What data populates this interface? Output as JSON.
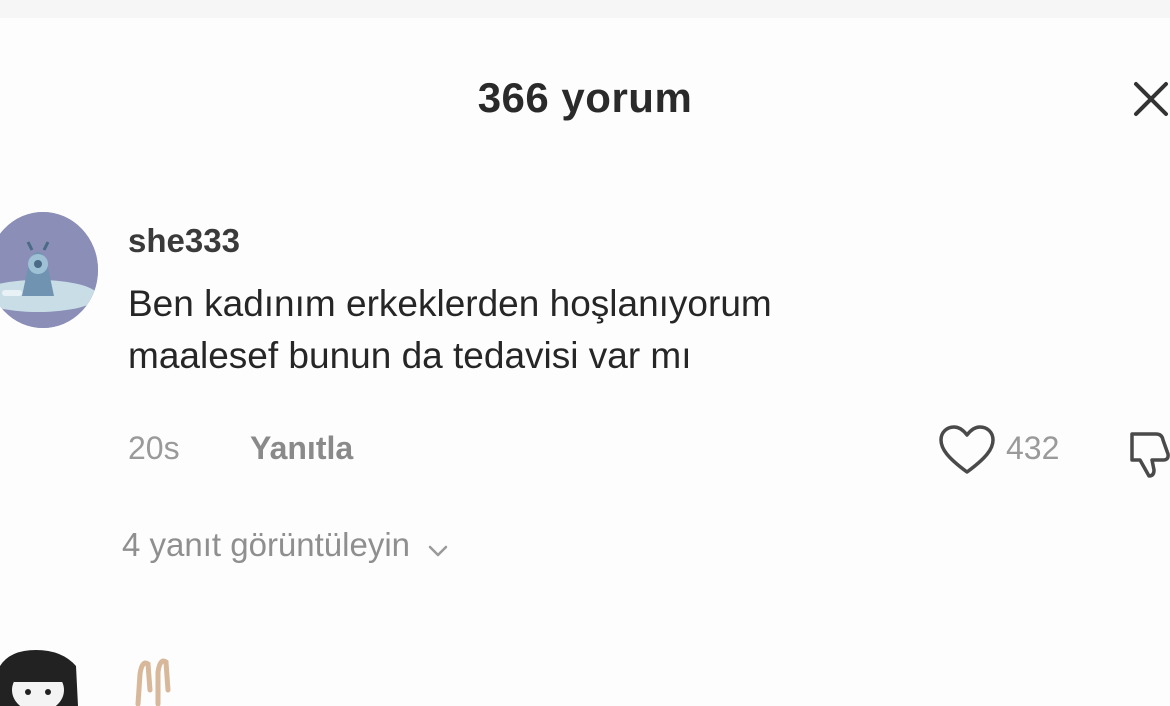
{
  "header": {
    "title": "366 yorum",
    "close_icon": "close-icon"
  },
  "comment": {
    "username": "she333",
    "text_line1": "Ben kadınım erkeklerden hoşlanıyorum",
    "text_line2": "maalesef bunun da tedavisi var mı",
    "time": "20s",
    "reply_label": "Yanıtla",
    "like_icon": "heart-icon",
    "like_count": "432",
    "dislike_icon": "thumbs-down-icon"
  },
  "replies": {
    "view_label": "4 yanıt görüntüleyin",
    "chevron_icon": "chevron-down-icon"
  },
  "colors": {
    "background": "#fdfdfd",
    "text_primary": "#262626",
    "text_secondary": "#9a9a9a",
    "avatar_bg": "#8b8fb8"
  }
}
